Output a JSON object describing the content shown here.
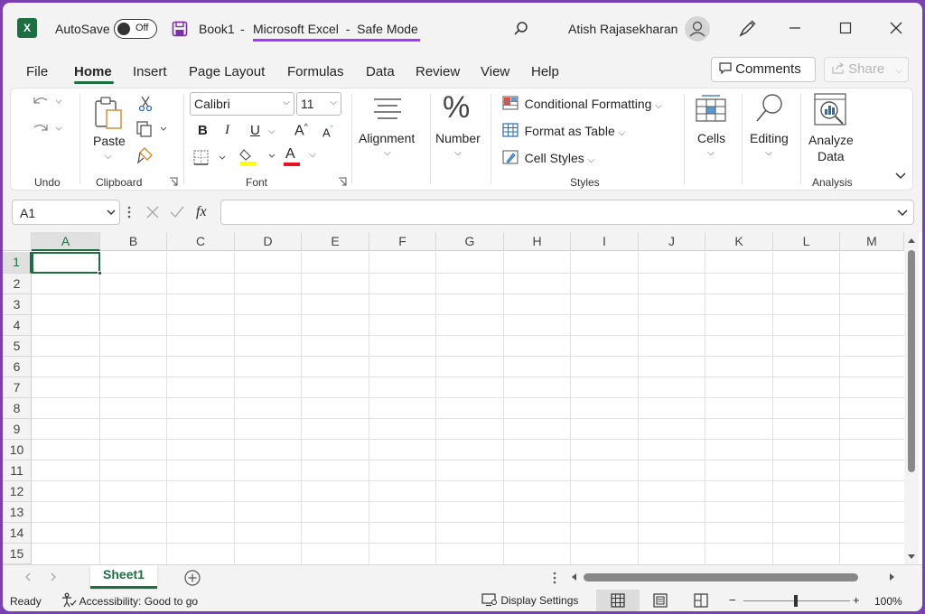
{
  "titlebar": {
    "app_icon": "excel-logo",
    "app_icon_letter": "X",
    "autosave_label": "AutoSave",
    "autosave_state": "Off",
    "document_name": "Book1",
    "separator1": "-",
    "app_title": "Microsoft Excel  -  Safe Mode",
    "user_name": "Atish Rajasekharan",
    "highlight_color": "#a238ff"
  },
  "menu": {
    "tabs": [
      "File",
      "Home",
      "Insert",
      "Page Layout",
      "Formulas",
      "Data",
      "Review",
      "View",
      "Help"
    ],
    "active_tab": "Home",
    "comments_label": "Comments",
    "share_label": "Share"
  },
  "ribbon": {
    "undo_group": "Undo",
    "clipboard": {
      "paste_label": "Paste",
      "group_label": "Clipboard"
    },
    "font": {
      "font_name": "Calibri",
      "font_size": "11",
      "bold": "B",
      "italic": "I",
      "underline": "U",
      "grow": "A",
      "shrink": "A",
      "font_color_letter": "A",
      "group_label": "Font",
      "font_color": "#e81123",
      "fill_color": "#ffff00"
    },
    "alignment_label": "Alignment",
    "number_label": "Number",
    "number_glyph": "%",
    "styles": {
      "conditional_formatting": "Conditional Formatting",
      "format_as_table": "Format as Table",
      "cell_styles": "Cell Styles",
      "group_label": "Styles"
    },
    "cells_label": "Cells",
    "editing_label": "Editing",
    "analyze_label_1": "Analyze",
    "analyze_label_2": "Data",
    "analysis_group": "Analysis"
  },
  "formula_bar": {
    "name_box": "A1",
    "fx_label": "fx",
    "formula": ""
  },
  "grid": {
    "columns": [
      "A",
      "B",
      "C",
      "D",
      "E",
      "F",
      "G",
      "H",
      "I",
      "J",
      "K",
      "L",
      "M"
    ],
    "rows": [
      "1",
      "2",
      "3",
      "4",
      "5",
      "6",
      "7",
      "8",
      "9",
      "10",
      "11",
      "12",
      "13",
      "14",
      "15"
    ],
    "active_cell": "A1",
    "accent_color": "#1d6f42"
  },
  "sheets": {
    "tabs": [
      "Sheet1"
    ],
    "active": "Sheet1"
  },
  "status": {
    "ready": "Ready",
    "accessibility": "Accessibility: Good to go",
    "display_settings": "Display Settings",
    "zoom": "100%",
    "zoom_minus": "−",
    "zoom_plus": "+"
  }
}
